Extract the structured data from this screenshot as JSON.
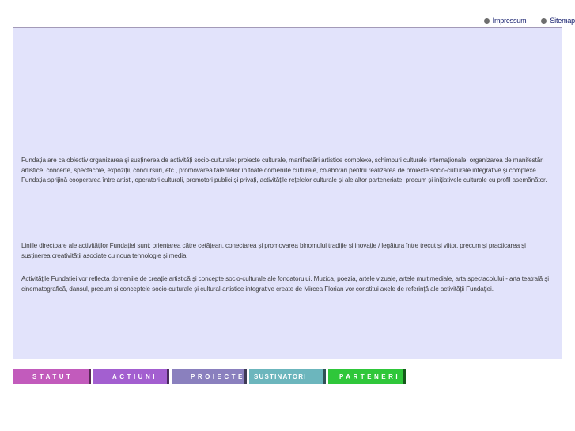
{
  "header": {
    "links": [
      {
        "label": "Impressum"
      },
      {
        "label": "Sitemap"
      }
    ]
  },
  "content": {
    "paragraphs": [
      "Fundația are ca obiectiv organizarea și susținerea de activități socio-culturale: proiecte culturale, manifestări artistice complexe, schimburi culturale internaționale, organizarea de manifestări artistice, concerte, spectacole, expoziții, concursuri, etc., promovarea talentelor în toate domeniile culturale, colaborări pentru realizarea de proiecte socio-culturale integrative și complexe. Fundația sprijină cooperarea între artiști, operatori culturali, promotori publici și privați, activitățile rețelelor culturale și ale altor parteneriate, precum și inițiativele culturale cu profil asemănător.",
      "Liniile directoare ale activităților Fundației sunt: orientarea către cetățean, conectarea și promovarea binomului tradiție și inovație / legătura între trecut și viitor, precum și practicarea și susținerea creativității asociate cu noua tehnologie și media.",
      "Activitățile Fundației vor reflecta domeniile de creație artistică și concepte socio-culturale ale fondatorului. Muzica, poezia, artele vizuale, artele multimediale, arta spectacolului - arta teatrală și cinematografică, dansul, precum și conceptele socio-culturale și cultural-artistice integrative create de Mircea Florian vor constitui axele de referință ale activității Fundației."
    ]
  },
  "nav": {
    "tabs": [
      {
        "label": "STATUT",
        "color": "#c25bbc"
      },
      {
        "label": "ACTIUNI",
        "color": "#a35fd0"
      },
      {
        "label": "PROIECTE",
        "color": "#8a80be"
      },
      {
        "label": "SUSTINATORI",
        "color": "#6cb6bd"
      },
      {
        "label": "PARTENERI",
        "color": "#2fc73a"
      }
    ]
  },
  "colors": {
    "panel_background": "#e2e3fb",
    "link_text": "#101a6a"
  }
}
